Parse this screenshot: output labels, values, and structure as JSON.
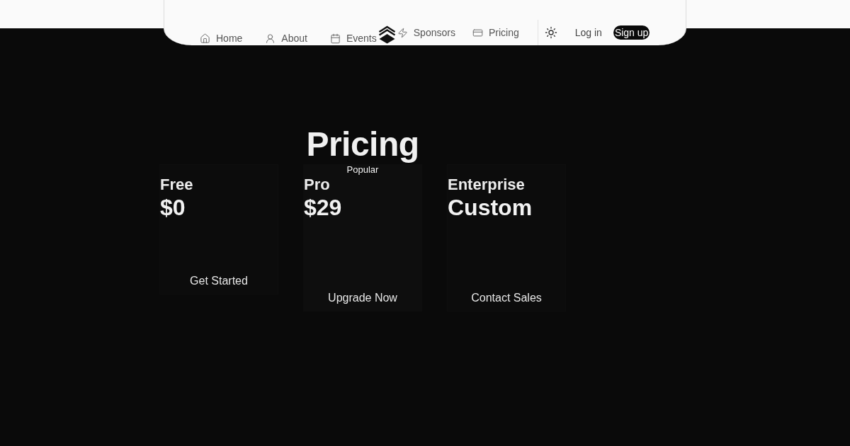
{
  "nav": {
    "links": [
      {
        "label": "Home"
      },
      {
        "label": "About"
      },
      {
        "label": "Events"
      },
      {
        "label": "Sponsors"
      },
      {
        "label": "Pricing"
      }
    ],
    "login": "Log in",
    "signup": "Sign up"
  },
  "title": "Pricing",
  "plans": [
    {
      "name": "Free",
      "price": "$0",
      "button": "Get Started"
    },
    {
      "name": "Pro",
      "price": "$29",
      "badge": "Popular",
      "button": "Upgrade Now"
    },
    {
      "name": "Enterprise",
      "price": "Custom",
      "button": "Contact Sales"
    }
  ]
}
